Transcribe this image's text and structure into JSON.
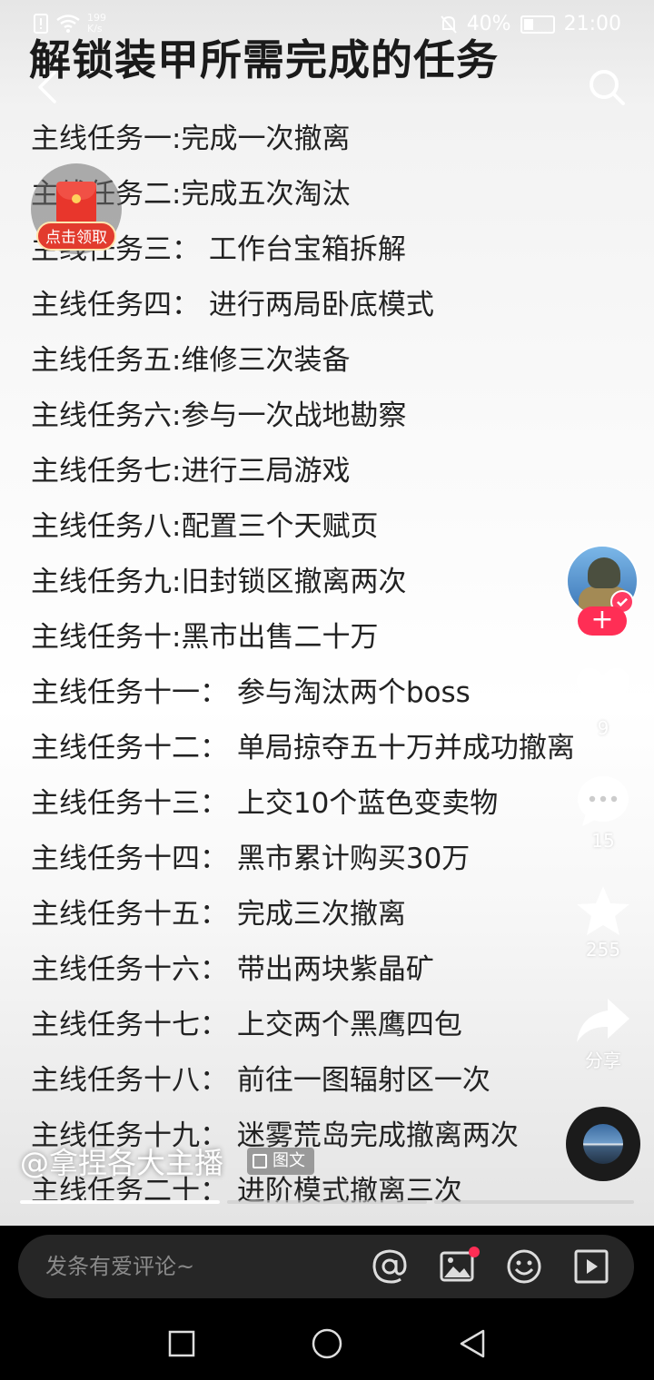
{
  "status_bar": {
    "speed_value": "199",
    "speed_unit": "K/s",
    "battery_percent": "40%",
    "battery_level": 0.4,
    "time": "21:00"
  },
  "post": {
    "title": "解锁装甲所需完成的任务",
    "tasks": [
      "主线任务一:完成一次撤离",
      "主线任务二:完成五次淘汰",
      "主线任务三： 工作台宝箱拆解",
      "主线任务四： 进行两局卧底模式",
      "主线任务五:维修三次装备",
      "主线任务六:参与一次战地勘察",
      "主线任务七:进行三局游戏",
      "主线任务八:配置三个天赋页",
      "主线任务九:旧封锁区撤离两次",
      "主线任务十:黑市出售二十万",
      "主线任务十一： 参与淘汰两个boss",
      "主线任务十二： 单局掠夺五十万并成功撤离",
      "主线任务十三： 上交10个蓝色变卖物",
      "主线任务十四： 黑市累计购买30万",
      "主线任务十五： 完成三次撤离",
      "主线任务十六： 带出两块紫晶矿",
      "主线任务十七： 上交两个黑鹰四包",
      "主线任务十八： 前往一图辐射区一次",
      "主线任务十九： 迷雾荒岛完成撤离两次",
      "主线任务二十： 进阶模式撤离三次"
    ],
    "author": "@拿捏各大主播",
    "type_badge": "图文",
    "progress": [
      1.0,
      0.0,
      0.0
    ]
  },
  "red_packet": {
    "label": "点击领取"
  },
  "actions": {
    "follow_label": "+",
    "likes": "9",
    "comments": "15",
    "favorites": "255",
    "share_label": "分享"
  },
  "comment_bar": {
    "placeholder": "发条有爱评论~"
  },
  "colors": {
    "accent": "#ff2e55",
    "red_packet": "#e8362c"
  }
}
